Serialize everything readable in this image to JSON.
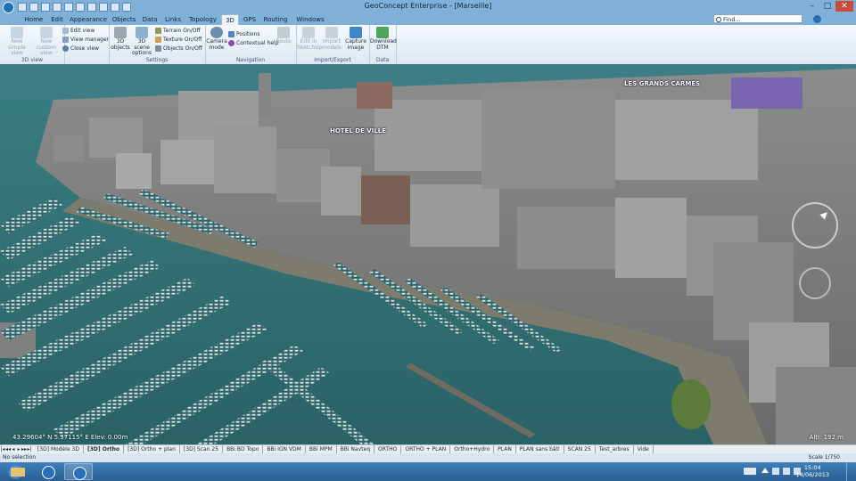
{
  "window": {
    "title": "GeoConcept Enterprise - [Marseille]",
    "controls": [
      "–",
      "□",
      "✕"
    ],
    "help_icon": "help-icon"
  },
  "tabs": [
    "Home",
    "Edit",
    "Appearance",
    "Objects",
    "Data",
    "Links",
    "Topology",
    "3D",
    "GPS",
    "Routing",
    "Windows"
  ],
  "active_tab": "3D",
  "find": {
    "placeholder": "Find..."
  },
  "ribbon": {
    "groups": {
      "view3d": "3D view",
      "settings": "Settings",
      "navigation": "Navigation",
      "import_export": "Import/Export",
      "data": "Data"
    },
    "new_simple_view": "New simple view",
    "new_custom_view": "New custom view",
    "edit_view": "Edit view",
    "view_manager": "View manager",
    "close_view": "Close view",
    "objects_3d": "3D objects",
    "scene_options": "3D scene options",
    "terrain": "Terrain On/Off",
    "texture": "Texture On/Off",
    "objects_onoff": "Objects On/Off",
    "camera_mode": "Camera mode",
    "positions": "Positions",
    "contextual_help": "Contextual help",
    "route": "Route",
    "edit_sketchup": "Edit in SketchUp",
    "import_models": "Import models",
    "capture_image": "Capture image",
    "download_dtm": "Download DTM"
  },
  "viewport": {
    "labels": {
      "hotel": "HOTEL DE VILLE",
      "grands_carmes": "LES GRANDS CARMES"
    },
    "coords": "43.29604° N  5.37115° E    Elev: 0.00m",
    "altitude": "Alti: 192 m"
  },
  "layer_tabs": [
    "[3D] Modèle 3D",
    "[3D] Ortho",
    "[3D] Ortho + plan",
    "[3D] Scan 25",
    "BBi BD Topo",
    "BBi IGN VDM",
    "BBi MPM",
    "BBi Navteq",
    "ORTHO",
    "ORTHO + PLAN",
    "Ortho+Hydro",
    "PLAN",
    "PLAN sans bâti",
    "SCAN 25",
    "Test_arbres",
    "Vide"
  ],
  "active_layer": "[3D] Ortho",
  "status": {
    "selection": "No selection",
    "scale": "Scale 1/750"
  },
  "taskbar": {
    "time": "15:04",
    "date": "14/06/2013"
  },
  "colors": {
    "water": "#2f6f74",
    "titlebar": "#7fb1d8",
    "ribbon": "#eef5fb",
    "buildings": "#8a8a8a",
    "labels": "#ffffff"
  }
}
